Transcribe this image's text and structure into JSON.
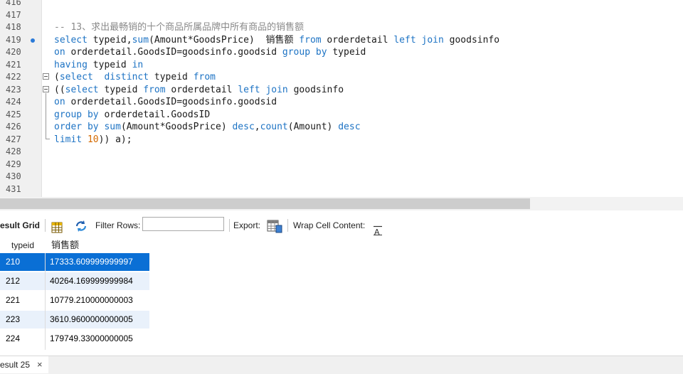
{
  "editor": {
    "lines": [
      {
        "num": "416",
        "html": ""
      },
      {
        "num": "417",
        "html": ""
      },
      {
        "num": "418",
        "html": "<span class=\"cm\">-- 13、求出最畅销的十个商品所属品牌中所有商品的销售额</span>"
      },
      {
        "num": "419",
        "html": "<span class=\"kw\">select</span> typeid,<span class=\"kw\">sum</span>(Amount*GoodsPrice)  <span class=\"cjk\">销售额</span> <span class=\"kw\">from</span> orderdetail <span class=\"kw\">left</span> <span class=\"kw\">join</span> goodsinfo"
      },
      {
        "num": "420",
        "html": "<span class=\"kw\">on</span> orderdetail.GoodsID=goodsinfo.goodsid <span class=\"kw\">group</span> <span class=\"kw\">by</span> typeid"
      },
      {
        "num": "421",
        "html": "<span class=\"kw\">having</span> typeid <span class=\"kw\">in</span>"
      },
      {
        "num": "422",
        "html": "(<span class=\"kw\">select</span>  <span class=\"kw\">distinct</span> typeid <span class=\"kw\">from</span>"
      },
      {
        "num": "423",
        "html": "((<span class=\"kw\">select</span> typeid <span class=\"kw\">from</span> orderdetail <span class=\"kw\">left</span> <span class=\"kw\">join</span> goodsinfo"
      },
      {
        "num": "424",
        "html": "<span class=\"kw\">on</span> orderdetail.GoodsID=goodsinfo.goodsid"
      },
      {
        "num": "425",
        "html": "<span class=\"kw\">group</span> <span class=\"kw\">by</span> orderdetail.GoodsID"
      },
      {
        "num": "426",
        "html": "<span class=\"kw\">order</span> <span class=\"kw\">by</span> <span class=\"kw\">sum</span>(Amount*GoodsPrice) <span class=\"kw\">desc</span>,<span class=\"kw\">count</span>(Amount) <span class=\"kw\">desc</span>"
      },
      {
        "num": "427",
        "html": "<span class=\"kw\">limit</span> <span class=\"num\">10</span>)) a);"
      },
      {
        "num": "428",
        "html": ""
      },
      {
        "num": "429",
        "html": ""
      },
      {
        "num": "430",
        "html": ""
      },
      {
        "num": "431",
        "html": ""
      }
    ]
  },
  "toolbar": {
    "result_grid_label": "esult Grid",
    "filter_rows_label": "Filter Rows:",
    "filter_value": "",
    "export_label": "Export:",
    "wrap_label": "Wrap Cell Content:"
  },
  "grid": {
    "columns": [
      "typeid",
      "销售额"
    ],
    "rows": [
      [
        "210",
        "17333.609999999997"
      ],
      [
        "212",
        "40264.169999999984"
      ],
      [
        "221",
        "10779.210000000003"
      ],
      [
        "223",
        "3610.9600000000005"
      ],
      [
        "224",
        "179749.33000000005"
      ]
    ]
  },
  "tabs": {
    "result_tab": "esult 25",
    "close_glyph": "×"
  }
}
